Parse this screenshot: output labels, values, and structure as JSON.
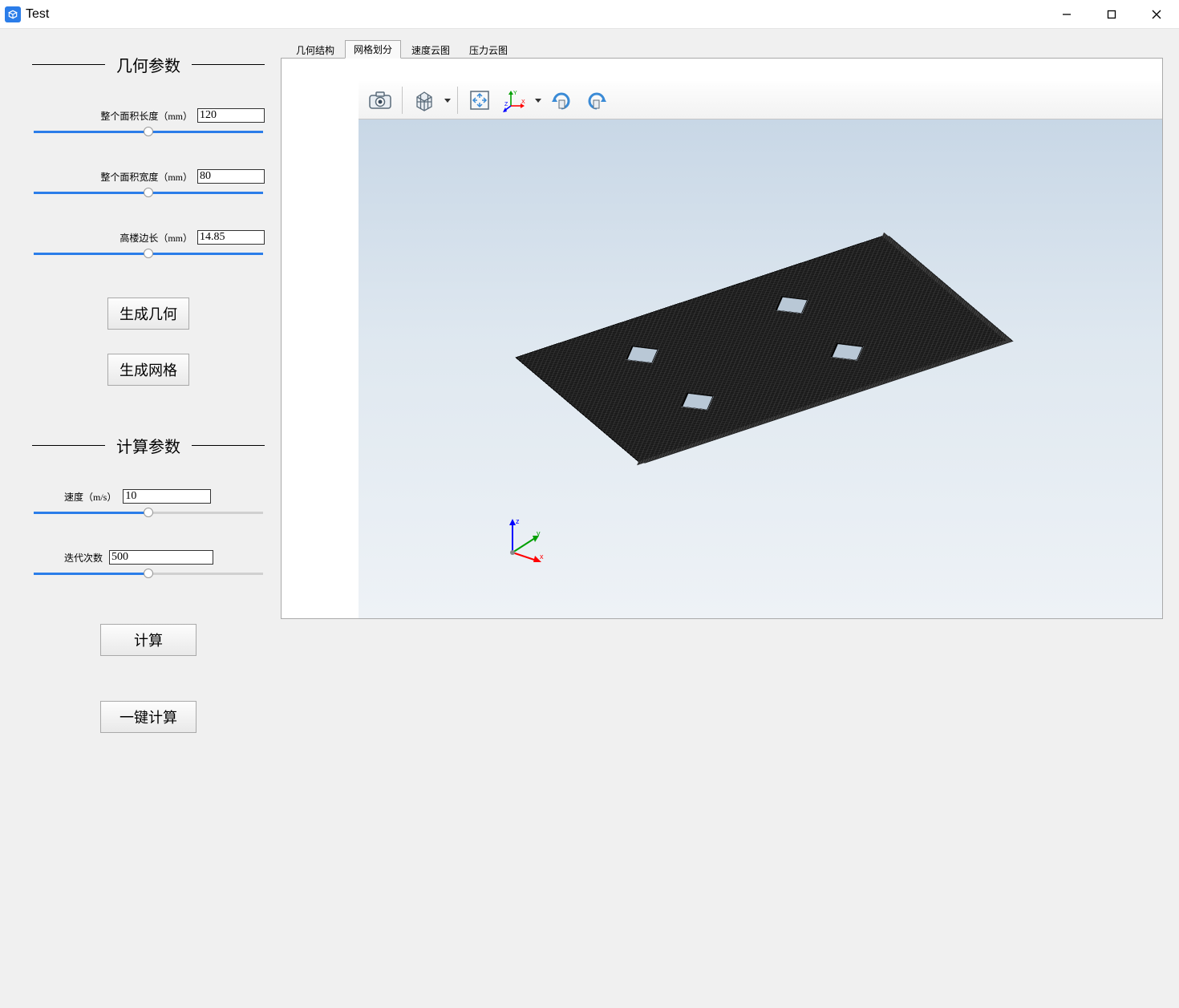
{
  "window": {
    "title": "Test"
  },
  "sections": {
    "geometry": {
      "title": "几何参数"
    },
    "compute": {
      "title": "计算参数"
    }
  },
  "params": {
    "length": {
      "label": "整个面积长度（mm）",
      "value": "120",
      "pct": 100
    },
    "width": {
      "label": "整个面积宽度（mm）",
      "value": "80",
      "pct": 100
    },
    "tower": {
      "label": "高楼边长（mm）",
      "value": "14.85",
      "pct": 100
    },
    "velocity": {
      "label": "速度（m/s）",
      "value": "10",
      "pct": 50
    },
    "iters": {
      "label": "迭代次数",
      "value": "500",
      "pct": 50
    }
  },
  "buttons": {
    "gen_geometry": "生成几何",
    "gen_mesh": "生成网格",
    "compute": "计算",
    "one_click": "一键计算"
  },
  "tabs": [
    {
      "label": "几何结构",
      "active": false
    },
    {
      "label": "网格划分",
      "active": true
    },
    {
      "label": "速度云图",
      "active": false
    },
    {
      "label": "压力云图",
      "active": false
    }
  ],
  "toolbar3d": {
    "camera": "camera-icon",
    "cube": "view-cube-icon",
    "fit": "fit-view-icon",
    "axes": "xyz-axes-icon",
    "rotate_cw": "rotate-cw-icon",
    "rotate_ccw": "rotate-ccw-icon"
  },
  "triad": {
    "x": "x",
    "y": "y",
    "z": "z"
  },
  "colors": {
    "accent": "#2b7de9",
    "axis_x": "#ff0000",
    "axis_y": "#00a000",
    "axis_z": "#0000ff"
  }
}
